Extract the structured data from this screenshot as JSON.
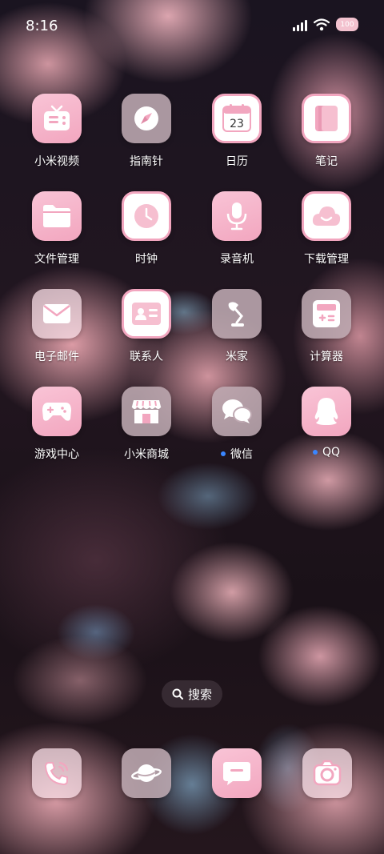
{
  "status_bar": {
    "time": "8:16",
    "battery": "100",
    "icons": [
      "signal-icon",
      "wifi-icon",
      "battery-icon"
    ]
  },
  "apps": [
    {
      "label": "小米视频",
      "icon": "tv-icon"
    },
    {
      "label": "指南针",
      "icon": "compass-icon"
    },
    {
      "label": "日历",
      "icon": "calendar-icon",
      "date": "23"
    },
    {
      "label": "笔记",
      "icon": "notes-icon"
    },
    {
      "label": "文件管理",
      "icon": "folder-icon"
    },
    {
      "label": "时钟",
      "icon": "clock-icon"
    },
    {
      "label": "录音机",
      "icon": "microphone-icon"
    },
    {
      "label": "下载管理",
      "icon": "cloud-download-icon"
    },
    {
      "label": "电子邮件",
      "icon": "mail-icon"
    },
    {
      "label": "联系人",
      "icon": "contact-card-icon"
    },
    {
      "label": "米家",
      "icon": "desk-lamp-icon"
    },
    {
      "label": "计算器",
      "icon": "calculator-icon"
    },
    {
      "label": "游戏中心",
      "icon": "gamepad-icon"
    },
    {
      "label": "小米商城",
      "icon": "store-icon"
    },
    {
      "label": "微信",
      "icon": "wechat-icon",
      "new_install_dot": true
    },
    {
      "label": "QQ",
      "icon": "qq-penguin-icon",
      "new_install_dot": true
    }
  ],
  "search": {
    "label": "搜索",
    "icon": "search-icon"
  },
  "dock": [
    {
      "icon": "phone-icon"
    },
    {
      "icon": "browser-planet-icon"
    },
    {
      "icon": "message-icon"
    },
    {
      "icon": "camera-icon"
    }
  ],
  "colors": {
    "icon_pink": "#f2a6bf",
    "icon_grey": "#bfa9b2",
    "dot_blue": "#3a86ff"
  }
}
